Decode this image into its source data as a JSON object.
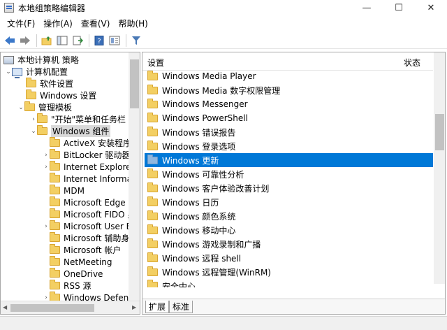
{
  "window": {
    "title": "本地组策略编辑器",
    "controls": {
      "minimize": "—",
      "maximize": "☐",
      "close": "✕"
    }
  },
  "menu": [
    "文件(F)",
    "操作(A)",
    "查看(V)",
    "帮助(H)"
  ],
  "toolbar": {
    "icons": [
      "back-arrow-icon",
      "forward-arrow-icon",
      "folder-up-icon",
      "show-hide-tree-icon",
      "export-list-icon",
      "help-icon",
      "properties-icon",
      "filter-icon"
    ],
    "colors": {
      "arrow": "#3b78c9",
      "filter": "#4a79b5"
    }
  },
  "tree": {
    "items": [
      {
        "label": "本地计算机 策略",
        "level": 0,
        "toggle": "",
        "icon": "policy-icon"
      },
      {
        "label": "计算机配置",
        "level": 1,
        "toggle": "⌄",
        "icon": "computer-icon"
      },
      {
        "label": "软件设置",
        "level": 2,
        "toggle": "",
        "icon": "folder-icon"
      },
      {
        "label": "Windows 设置",
        "level": 2,
        "toggle": "",
        "icon": "folder-icon"
      },
      {
        "label": "管理模板",
        "level": 2,
        "toggle": "⌄",
        "icon": "folder-icon"
      },
      {
        "label": "\"开始\"菜单和任务栏",
        "level": 3,
        "toggle": "›",
        "icon": "folder-icon"
      },
      {
        "label": "Windows 组件",
        "level": 3,
        "toggle": "⌄",
        "icon": "folder-icon",
        "selected": true
      },
      {
        "label": "ActiveX 安装程序",
        "level": 4,
        "toggle": "",
        "icon": "folder-icon"
      },
      {
        "label": "BitLocker 驱动器",
        "level": 4,
        "toggle": "›",
        "icon": "folder-icon"
      },
      {
        "label": "Internet Explorer",
        "level": 4,
        "toggle": "›",
        "icon": "folder-icon"
      },
      {
        "label": "Internet Informa",
        "level": 4,
        "toggle": "",
        "icon": "folder-icon"
      },
      {
        "label": "MDM",
        "level": 4,
        "toggle": "",
        "icon": "folder-icon"
      },
      {
        "label": "Microsoft Edge",
        "level": 4,
        "toggle": "",
        "icon": "folder-icon"
      },
      {
        "label": "Microsoft FIDO 身",
        "level": 4,
        "toggle": "",
        "icon": "folder-icon"
      },
      {
        "label": "Microsoft User E",
        "level": 4,
        "toggle": "›",
        "icon": "folder-icon"
      },
      {
        "label": "Microsoft 辅助身",
        "level": 4,
        "toggle": "",
        "icon": "folder-icon"
      },
      {
        "label": "Microsoft 帐户",
        "level": 4,
        "toggle": "",
        "icon": "folder-icon"
      },
      {
        "label": "NetMeeting",
        "level": 4,
        "toggle": "",
        "icon": "folder-icon"
      },
      {
        "label": "OneDrive",
        "level": 4,
        "toggle": "",
        "icon": "folder-icon"
      },
      {
        "label": "RSS 源",
        "level": 4,
        "toggle": "",
        "icon": "folder-icon"
      },
      {
        "label": "Windows Defen",
        "level": 4,
        "toggle": "›",
        "icon": "folder-icon"
      }
    ]
  },
  "list": {
    "header": {
      "setting": "设置",
      "state": "状态"
    },
    "items": [
      {
        "label": "Windows Media Player"
      },
      {
        "label": "Windows Media 数字权限管理"
      },
      {
        "label": "Windows Messenger"
      },
      {
        "label": "Windows PowerShell"
      },
      {
        "label": "Windows 错误报告"
      },
      {
        "label": "Windows 登录选项"
      },
      {
        "label": "Windows 更新",
        "selected": true
      },
      {
        "label": "Windows 可靠性分析"
      },
      {
        "label": "Windows 客户体验改善计划"
      },
      {
        "label": "Windows 日历"
      },
      {
        "label": "Windows 颜色系统"
      },
      {
        "label": "Windows 移动中心"
      },
      {
        "label": "Windows 游戏录制和广播"
      },
      {
        "label": "Windows 远程 shell"
      },
      {
        "label": "Windows 远程管理(WinRM)"
      },
      {
        "label": "安全中心"
      }
    ],
    "selection_color": "#0078d7"
  },
  "tabs": [
    "扩展",
    "标准"
  ]
}
